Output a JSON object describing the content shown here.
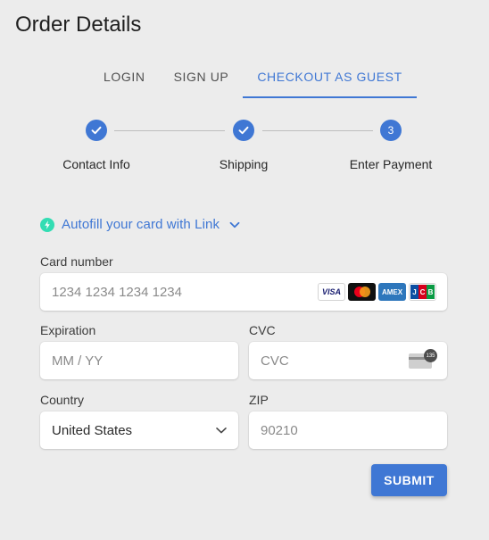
{
  "page": {
    "title": "Order Details"
  },
  "tabs": [
    {
      "label": "LOGIN",
      "active": false
    },
    {
      "label": "SIGN UP",
      "active": false
    },
    {
      "label": "CHECKOUT AS GUEST",
      "active": true
    }
  ],
  "stepper": {
    "steps": [
      {
        "label": "Contact Info",
        "state": "complete"
      },
      {
        "label": "Shipping",
        "state": "complete"
      },
      {
        "label": "Enter Payment",
        "number": "3",
        "state": "active"
      }
    ]
  },
  "autofill": {
    "label": "Autofill your card with Link"
  },
  "form": {
    "card_number": {
      "label": "Card number",
      "placeholder": "1234 1234 1234 1234",
      "brands": [
        "VISA",
        "mastercard",
        "AMEX",
        "JCB"
      ]
    },
    "expiration": {
      "label": "Expiration",
      "placeholder": "MM / YY"
    },
    "cvc": {
      "label": "CVC",
      "placeholder": "CVC",
      "badge": "135"
    },
    "country": {
      "label": "Country",
      "value": "United States"
    },
    "zip": {
      "label": "ZIP",
      "placeholder": "90210"
    },
    "submit_label": "SUBMIT"
  },
  "colors": {
    "accent": "#3f77d4",
    "link_green": "#33ddb3",
    "background": "#ececec"
  }
}
